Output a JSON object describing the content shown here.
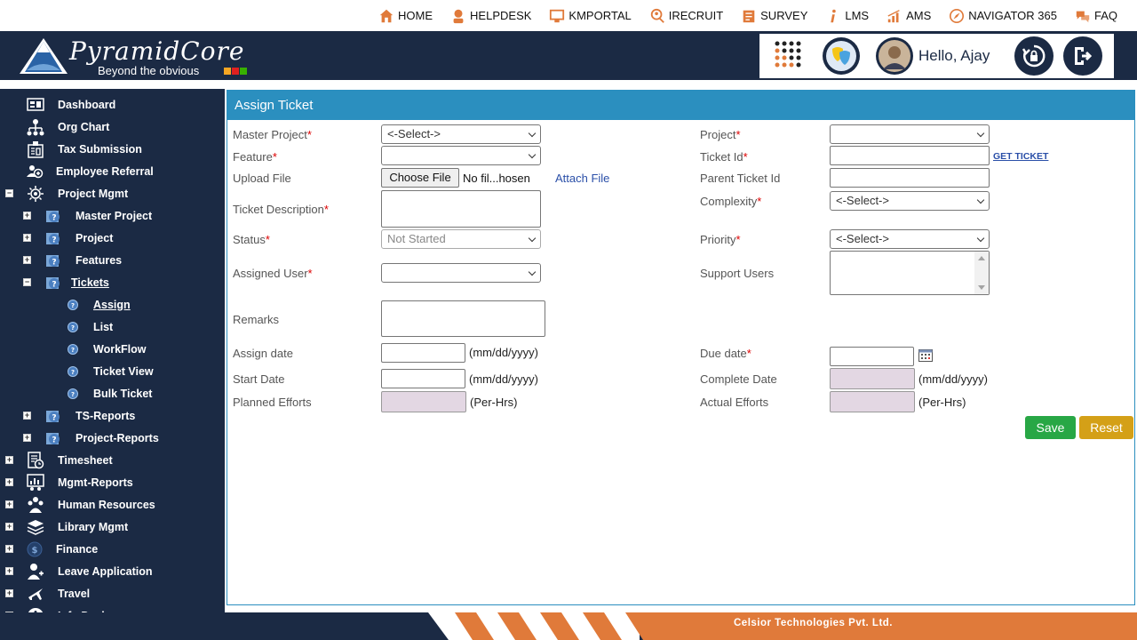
{
  "topnav": [
    {
      "label": "HOME",
      "icon": "home-icon"
    },
    {
      "label": "HELPDESK",
      "icon": "helpdesk-icon"
    },
    {
      "label": "KMPORTAL",
      "icon": "kmportal-icon"
    },
    {
      "label": "IRECRUIT",
      "icon": "irecruit-icon"
    },
    {
      "label": "SURVEY",
      "icon": "survey-icon"
    },
    {
      "label": "LMS",
      "icon": "lms-icon"
    },
    {
      "label": "AMS",
      "icon": "ams-icon"
    },
    {
      "label": "NAVIGATOR 365",
      "icon": "navigator-icon"
    },
    {
      "label": "FAQ",
      "icon": "faq-icon"
    }
  ],
  "header": {
    "logo_title": "PyramidCore",
    "logo_tagline": "Beyond the obvious",
    "greeting": "Hello, Ajay"
  },
  "sidebar": {
    "dashboard": "Dashboard",
    "org_chart": "Org Chart",
    "tax_submission": "Tax Submission",
    "employee_referral": "Employee Referral",
    "project_mgmt": "Project Mgmt",
    "master_project": "Master Project",
    "project": "Project",
    "features": "Features",
    "tickets": "Tickets",
    "assign": "Assign",
    "list": "List",
    "workflow": "WorkFlow",
    "ticket_view": "Ticket View",
    "bulk_ticket": "Bulk Ticket",
    "ts_reports": "TS-Reports",
    "project_reports": "Project-Reports",
    "timesheet": "Timesheet",
    "mgmt_reports": "Mgmt-Reports",
    "human_resources": "Human Resources",
    "library_mgmt": "Library Mgmt",
    "finance": "Finance",
    "leave_application": "Leave Application",
    "travel": "Travel",
    "info_desk": "Info Desk"
  },
  "form": {
    "title": "Assign Ticket",
    "master_project_label": "Master Project",
    "master_project_value": "<-Select->",
    "project_label": "Project",
    "feature_label": "Feature",
    "ticket_id_label": "Ticket Id",
    "get_ticket": "GET TICKET",
    "upload_file_label": "Upload File",
    "choose_file": "Choose File",
    "no_file": "No fil...hosen",
    "attach_file": "Attach File",
    "parent_ticket_label": "Parent Ticket Id",
    "ticket_desc_label": "Ticket Description",
    "complexity_label": "Complexity",
    "complexity_value": "<-Select->",
    "status_label": "Status",
    "status_value": "Not Started",
    "priority_label": "Priority",
    "priority_value": "<-Select->",
    "assigned_user_label": "Assigned User",
    "support_users_label": "Support Users",
    "remarks_label": "Remarks",
    "assign_date_label": "Assign date",
    "due_date_label": "Due date",
    "start_date_label": "Start Date",
    "complete_date_label": "Complete Date",
    "date_hint": "(mm/dd/yyyy)",
    "planned_efforts_label": "Planned Efforts",
    "actual_efforts_label": "Actual Efforts",
    "hours_hint": "(Per-Hrs)",
    "required_mark": "*",
    "save": "Save",
    "reset": "Reset"
  },
  "footer": {
    "company": "Celsior Technologies Pvt. Ltd."
  },
  "colors": {
    "navy": "#1b2a44",
    "panel_blue": "#2b8fbf",
    "orange": "#e07a3a",
    "save_green": "#28a745",
    "reset_gold": "#d4a017"
  }
}
